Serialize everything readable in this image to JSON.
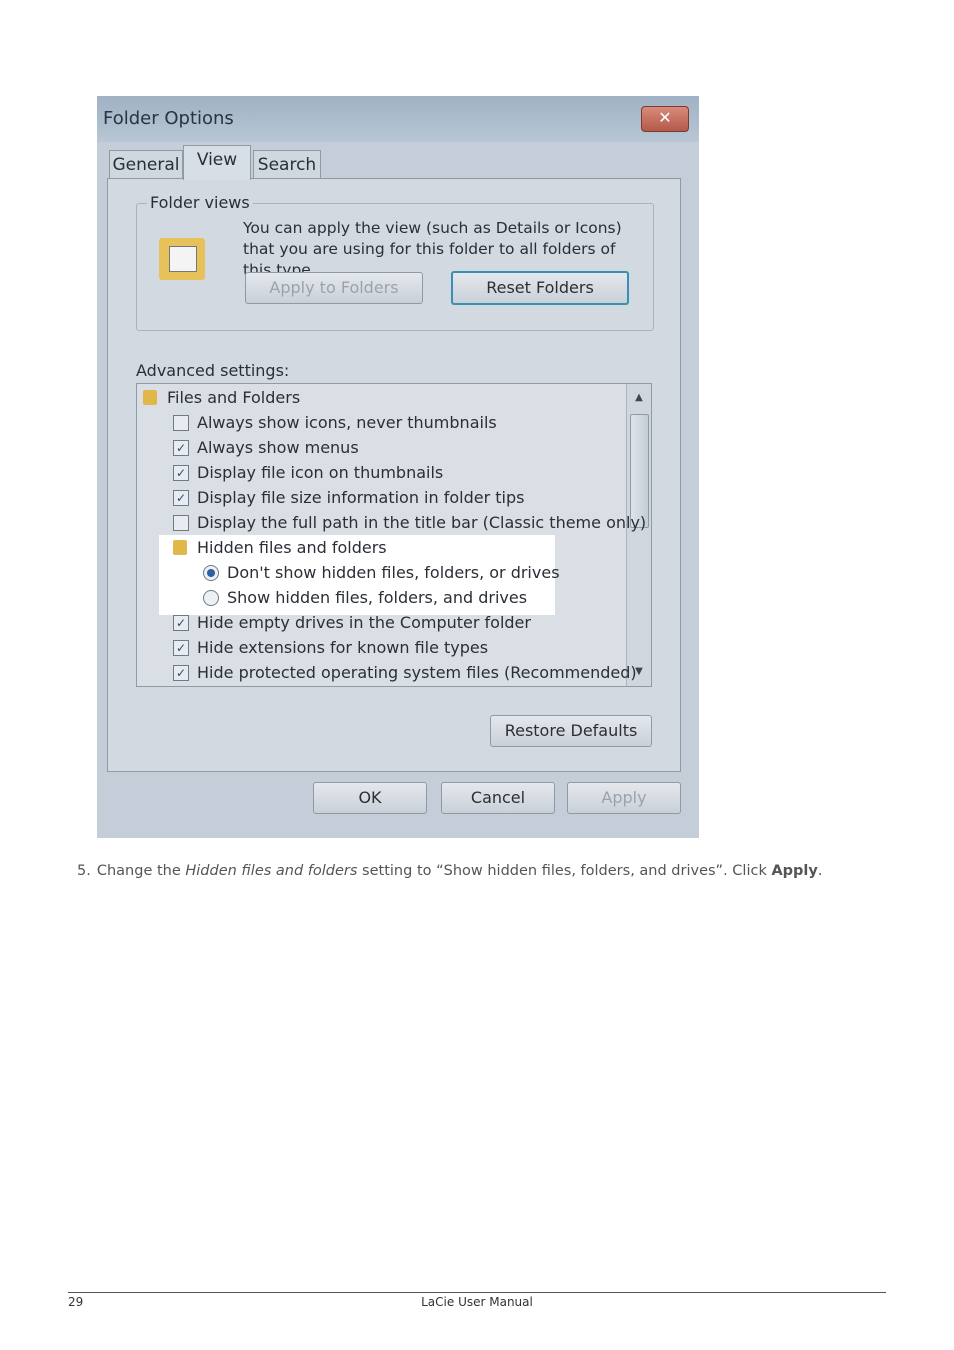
{
  "dialog": {
    "title": "Folder Options",
    "close_label": "✕",
    "tabs": [
      "General",
      "View",
      "Search"
    ],
    "folder_views": {
      "label": "Folder views",
      "description": "You can apply the view (such as Details or Icons) that you are using for this folder to all folders of this type.",
      "apply_button": "Apply to Folders",
      "reset_button": "Reset Folders"
    },
    "advanced_label": "Advanced settings:",
    "settings": [
      {
        "kind": "folder",
        "label": "Files and Folders",
        "indent": 0
      },
      {
        "kind": "checkbox",
        "label": "Always show icons, never thumbnails",
        "checked": false,
        "indent": 1
      },
      {
        "kind": "checkbox",
        "label": "Always show menus",
        "checked": true,
        "indent": 1
      },
      {
        "kind": "checkbox",
        "label": "Display file icon on thumbnails",
        "checked": true,
        "indent": 1
      },
      {
        "kind": "checkbox",
        "label": "Display file size information in folder tips",
        "checked": true,
        "indent": 1
      },
      {
        "kind": "checkbox",
        "label": "Display the full path in the title bar (Classic theme only)",
        "checked": false,
        "indent": 1
      },
      {
        "kind": "folder",
        "label": "Hidden files and folders",
        "indent": 1
      },
      {
        "kind": "radio",
        "label": "Don't show hidden files, folders, or drives",
        "checked": true,
        "indent": 2
      },
      {
        "kind": "radio",
        "label": "Show hidden files, folders, and drives",
        "checked": false,
        "indent": 2
      },
      {
        "kind": "checkbox",
        "label": "Hide empty drives in the Computer folder",
        "checked": true,
        "indent": 1
      },
      {
        "kind": "checkbox",
        "label": "Hide extensions for known file types",
        "checked": true,
        "indent": 1
      },
      {
        "kind": "checkbox",
        "label": "Hide protected operating system files (Recommended)",
        "checked": true,
        "indent": 1
      }
    ],
    "restore_button": "Restore Defaults",
    "ok_button": "OK",
    "cancel_button": "Cancel",
    "apply_button": "Apply"
  },
  "instruction": {
    "number": "5.",
    "prefix": "Change the ",
    "setting_name": "Hidden files and folders",
    "middle": " setting to “Show hidden files, folders, and drives”. Click ",
    "action": "Apply",
    "suffix": "."
  },
  "footer": {
    "page_number": "29",
    "manual_title": "LaCie User Manual"
  }
}
